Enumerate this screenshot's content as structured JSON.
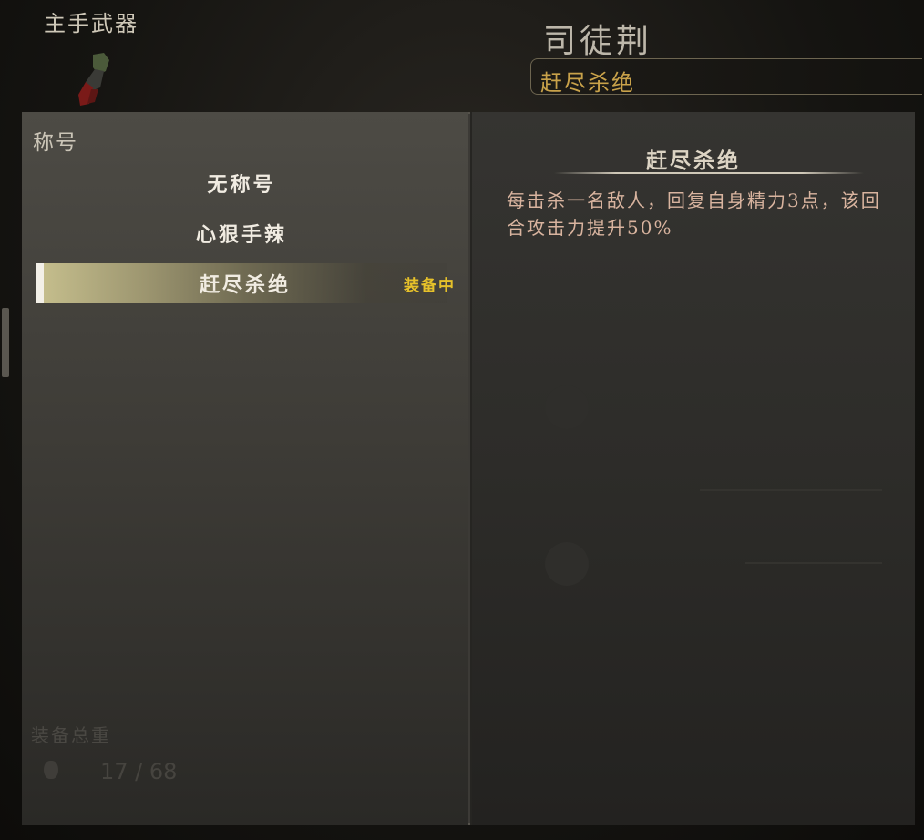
{
  "header": {
    "weapon_label": "主手武器",
    "character_name": "司徒荆",
    "current_title": "赶尽杀绝"
  },
  "titles_panel": {
    "label": "称号",
    "items": [
      {
        "label": "无称号",
        "selected": false
      },
      {
        "label": "心狠手辣",
        "selected": false
      },
      {
        "label": "赶尽杀绝",
        "selected": true
      }
    ],
    "equipped_badge": "装备中"
  },
  "detail": {
    "title": "赶尽杀绝",
    "description": "每击杀一名敌人，回复自身精力3点，该回合攻击力提升50%"
  },
  "background": {
    "weight_label": "装备总重",
    "weight_value": "17 / 68"
  },
  "colors": {
    "accent_gold": "#c9a24a",
    "equipped_yellow": "#e6c12a",
    "description_pink": "#d9b49f"
  },
  "icons": [
    "weapon-gauntlet-icon",
    "weight-icon"
  ]
}
